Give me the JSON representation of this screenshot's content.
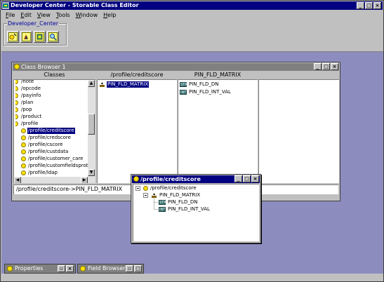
{
  "app": {
    "title": "Developer Center - Storable Class Editor",
    "window_controls": [
      "_",
      "□",
      "X"
    ]
  },
  "menu": [
    "File",
    "Edit",
    "View",
    "Tools",
    "Window",
    "Help"
  ],
  "toolbar": {
    "group_label": "Developer_Center",
    "buttons": [
      "class-editor-icon",
      "object-browser-icon",
      "testnap-icon",
      "field-browser-icon"
    ]
  },
  "class_browser": {
    "title": "Class Browser 1",
    "columns": {
      "classes": "Classes",
      "col2": "/profile/creditscore",
      "col3": "PIN_FLD_MATRIX"
    },
    "class_list": [
      {
        "label": "/note",
        "indent": 0,
        "icon": "half"
      },
      {
        "label": "/opcode",
        "indent": 0,
        "icon": "half"
      },
      {
        "label": "/payinfo",
        "indent": 0,
        "icon": "half"
      },
      {
        "label": "/plan",
        "indent": 0,
        "icon": "half"
      },
      {
        "label": "/pop",
        "indent": 0,
        "icon": "half"
      },
      {
        "label": "/product",
        "indent": 0,
        "icon": "half"
      },
      {
        "label": "/profile",
        "indent": 0,
        "icon": "half"
      },
      {
        "label": "/profile/creditscore",
        "indent": 1,
        "icon": "bulb",
        "selected": true
      },
      {
        "label": "/profile/credscore",
        "indent": 1,
        "icon": "bulb"
      },
      {
        "label": "/profile/cscore",
        "indent": 1,
        "icon": "bulb"
      },
      {
        "label": "/profile/custdata",
        "indent": 1,
        "icon": "bulb"
      },
      {
        "label": "/profile/customer_care",
        "indent": 1,
        "icon": "bulb"
      },
      {
        "label": "/profile/customfieldsprot",
        "indent": 1,
        "icon": "bulb"
      },
      {
        "label": "/profile/ldap",
        "indent": 1,
        "icon": "bulb"
      }
    ],
    "fields": [
      {
        "label": "PIN_FLD_MATRIX",
        "selected": true
      }
    ],
    "subfields": [
      {
        "label": "PIN_FLD_DN",
        "type": "STR"
      },
      {
        "label": "PIN_FLD_INT_VAL",
        "type": "INT"
      }
    ],
    "status": "/profile/creditscore->PIN_FLD_MATRIX"
  },
  "tree_window": {
    "title": "/profile/creditscore",
    "root": "/profile/creditscore",
    "node": "PIN_FLD_MATRIX",
    "leaves": [
      {
        "label": "PIN_FLD_DN",
        "type": "STR"
      },
      {
        "label": "PIN_FLD_INT_VAL",
        "type": "INT"
      }
    ]
  },
  "minimized": [
    {
      "title": "Properties"
    },
    {
      "title": "Field Browser"
    }
  ],
  "colors": {
    "titlebar_active": "#000080",
    "titlebar_inactive": "#808080",
    "desktop": "#8c8cbf",
    "face": "#c0c0c0"
  }
}
